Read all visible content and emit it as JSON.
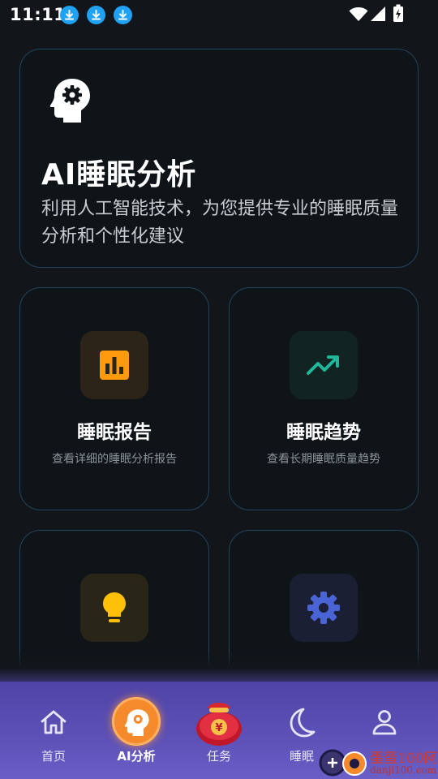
{
  "status_bar": {
    "time": "11:11",
    "download_icons": [
      "download-icon",
      "download-icon",
      "download-icon"
    ],
    "right_icons": [
      "wifi-icon",
      "signal-icon",
      "battery-charging-icon"
    ]
  },
  "hero": {
    "icon": "head-gear-icon",
    "title": "AI睡眠分析",
    "description": "利用人工智能技术，为您提供专业的睡眠质量分析和个性化建议"
  },
  "cards": [
    {
      "icon": "bar-chart-icon",
      "title": "睡眠报告",
      "subtitle": "查看详细的睡眠分析报告",
      "icon_color": "#ff9a0d",
      "icon_bg": "#2c2418"
    },
    {
      "icon": "trending-up-icon",
      "title": "睡眠趋势",
      "subtitle": "查看长期睡眠质量趋势",
      "icon_color": "#1fb89a",
      "icon_bg": "#122422"
    },
    {
      "icon": "lightbulb-icon",
      "title": "",
      "subtitle": "",
      "icon_color": "#ffc107",
      "icon_bg": "#2a2617"
    },
    {
      "icon": "gear-icon",
      "title": "",
      "subtitle": "",
      "icon_color": "#4a64d6",
      "icon_bg": "#1a1f33"
    }
  ],
  "bottom_nav": {
    "items": [
      {
        "label": "首页",
        "icon": "home-icon",
        "active": false
      },
      {
        "label": "AI分析",
        "icon": "head-gear-icon",
        "active": true
      },
      {
        "label": "任务",
        "icon": "money-bag-icon",
        "active": false
      },
      {
        "label": "睡眠",
        "icon": "moon-icon",
        "active": false
      },
      {
        "label": "",
        "icon": "person-icon",
        "active": false
      }
    ],
    "active_color": "#f58a2c"
  },
  "watermark": {
    "text": "蛋蛋100网",
    "url": "danji100.com"
  }
}
